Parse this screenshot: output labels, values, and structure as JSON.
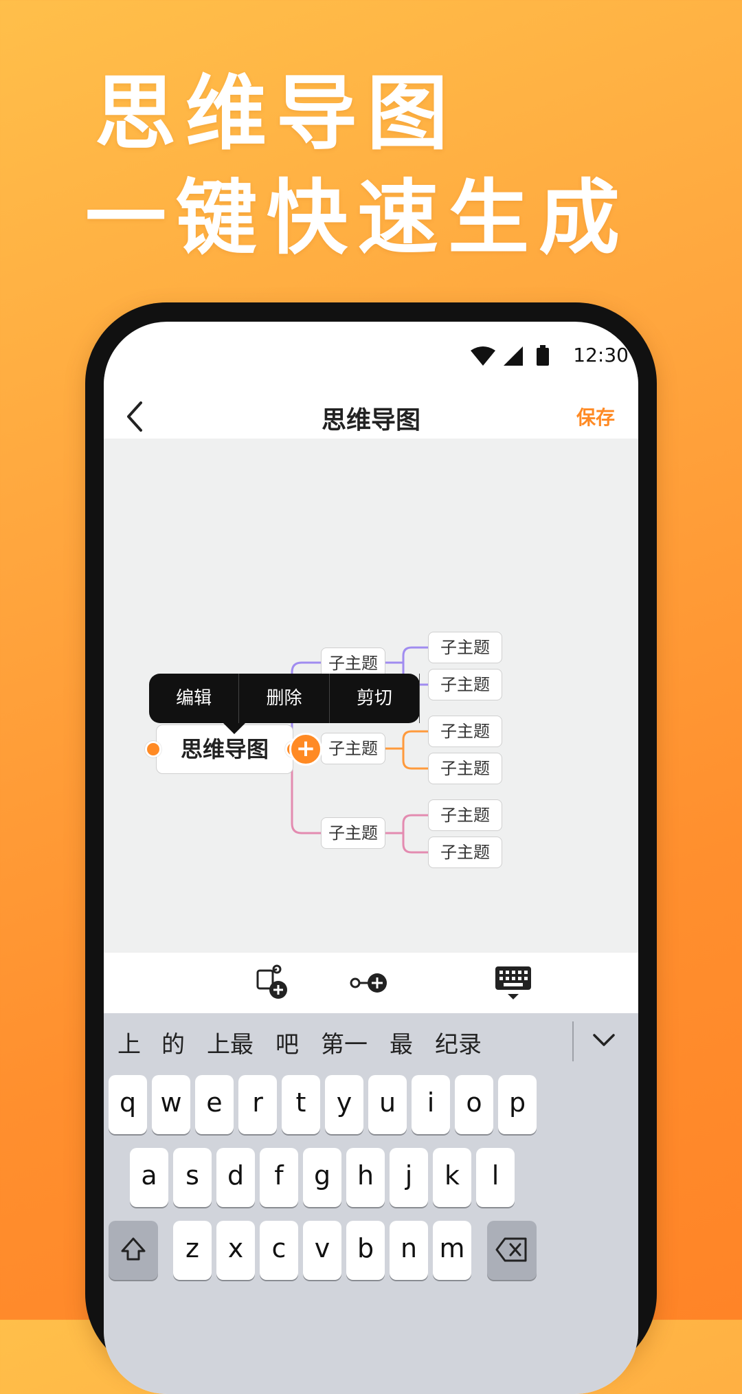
{
  "headline": {
    "line1": "思维导图",
    "line2": "一键快速生成"
  },
  "status": {
    "time": "12:30"
  },
  "nav": {
    "title": "思维导图",
    "save": "保存"
  },
  "mindmap": {
    "root": "思维导图",
    "branch_label": "子主题",
    "colors": {
      "purple": "#A08CF0",
      "orange": "#FF9A3C",
      "pink": "#E38BB0"
    }
  },
  "context_menu": {
    "items": [
      "编辑",
      "删除",
      "剪切"
    ]
  },
  "keyboard": {
    "candidates": [
      "上",
      "的",
      "上最",
      "吧",
      "第一",
      "最",
      "纪录"
    ],
    "row1": [
      "q",
      "w",
      "e",
      "r",
      "t",
      "y",
      "u",
      "i",
      "o",
      "p"
    ],
    "row2": [
      "a",
      "s",
      "d",
      "f",
      "g",
      "h",
      "j",
      "k",
      "l"
    ],
    "row3": [
      "z",
      "x",
      "c",
      "v",
      "b",
      "n",
      "m"
    ]
  }
}
